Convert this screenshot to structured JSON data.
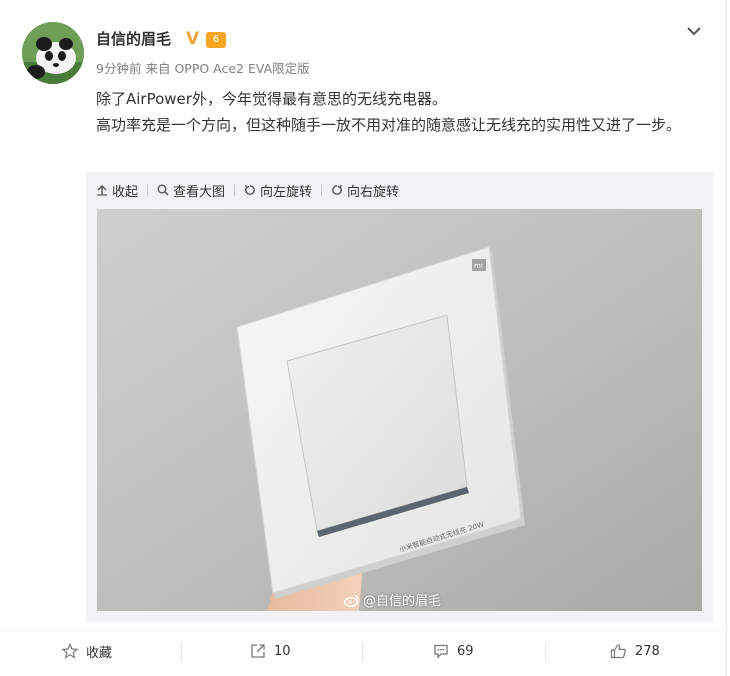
{
  "user": {
    "name": "自信的眉毛",
    "verified_badge": "V",
    "level_badge": "6"
  },
  "meta": {
    "time": "9分钟前",
    "source_prefix": "来自",
    "source": "OPPO Ace2 EVA限定版"
  },
  "post": {
    "lines": [
      "除了AirPower外，今年觉得最有意思的无线充电器。",
      "高功率充是一个方向，但这种随手一放不用对准的随意感让无线充的实用性又进了一步。"
    ]
  },
  "media_toolbar": {
    "collapse": "收起",
    "view_large": "查看大图",
    "rotate_left": "向左旋转",
    "rotate_right": "向右旋转"
  },
  "photo": {
    "box_text": "小米智能自动式无线充 20W",
    "box_logo": "mi",
    "watermark": "@自信的眉毛"
  },
  "actions": {
    "favorite": "收藏",
    "repost_count": "10",
    "comment_count": "69",
    "like_count": "278"
  },
  "colors": {
    "accent_orange": "#f0a53a",
    "text_primary": "#333333",
    "text_meta": "#808080",
    "media_bg": "#f2f2f5"
  }
}
